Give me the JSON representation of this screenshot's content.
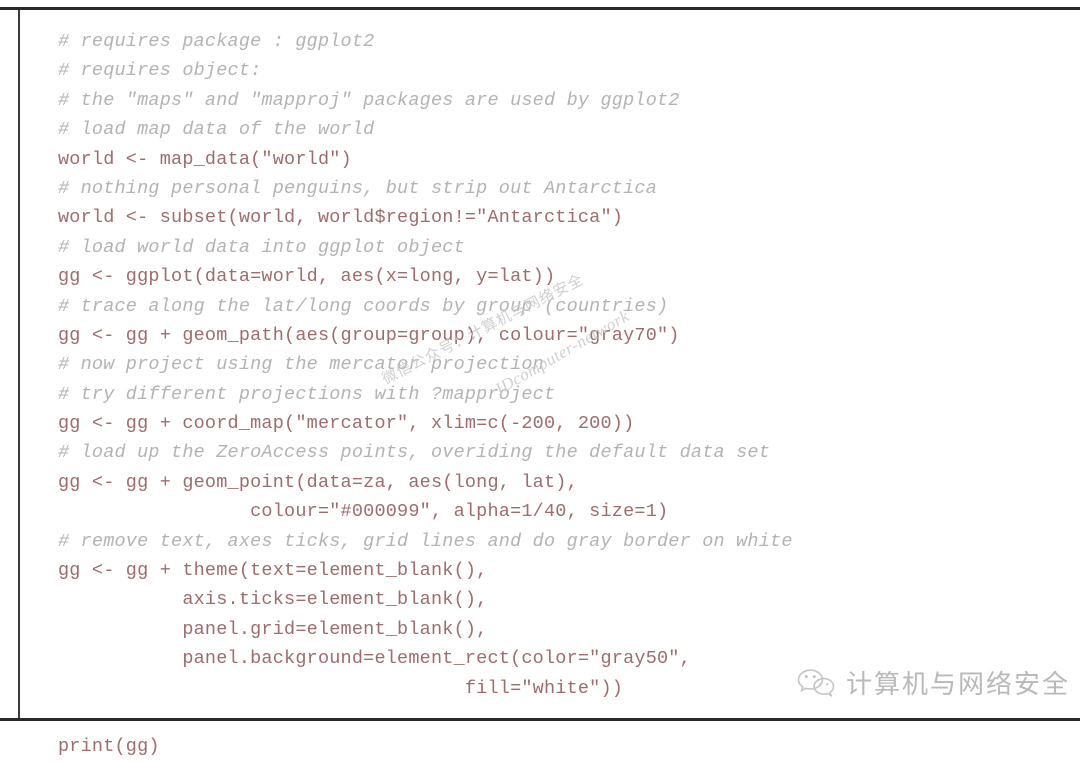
{
  "document": {
    "type": "code-listing",
    "language": "R",
    "title": "ggplot2 world map + ZeroAccess points code listing"
  },
  "colors": {
    "comment": "#b5b2b2",
    "code": "#9e6c6c",
    "rule": "#2b2b2b",
    "watermark": "#cdcdcd",
    "page_background": "#ffffff"
  },
  "code": {
    "lines": [
      {
        "kind": "comment",
        "text": "# requires package : ggplot2"
      },
      {
        "kind": "comment",
        "text": "# requires object:"
      },
      {
        "kind": "comment",
        "text": "# the \"maps\" and \"mapproj\" packages are used by ggplot2"
      },
      {
        "kind": "comment",
        "text": "# load map data of the world"
      },
      {
        "kind": "code",
        "text": "world <- map_data(\"world\")"
      },
      {
        "kind": "comment",
        "text": "# nothing personal penguins, but strip out Antarctica"
      },
      {
        "kind": "code",
        "text": "world <- subset(world, world$region!=\"Antarctica\")"
      },
      {
        "kind": "comment",
        "text": "# load world data into ggplot object"
      },
      {
        "kind": "code",
        "text": "gg <- ggplot(data=world, aes(x=long, y=lat))"
      },
      {
        "kind": "comment",
        "text": "# trace along the lat/long coords by group (countries)"
      },
      {
        "kind": "code",
        "text": "gg <- gg + geom_path(aes(group=group), colour=\"gray70\")"
      },
      {
        "kind": "comment",
        "text": "# now project using the mercator projection"
      },
      {
        "kind": "comment",
        "text": "# try different projections with ?mapproject"
      },
      {
        "kind": "code",
        "text": "gg <- gg + coord_map(\"mercator\", xlim=c(-200, 200))"
      },
      {
        "kind": "comment",
        "text": "# load up the ZeroAccess points, overiding the default data set"
      },
      {
        "kind": "code",
        "text": "gg <- gg + geom_point(data=za, aes(long, lat),"
      },
      {
        "kind": "code",
        "text": "                 colour=\"#000099\", alpha=1/40, size=1)"
      },
      {
        "kind": "comment",
        "text": "# remove text, axes ticks, grid lines and do gray border on white"
      },
      {
        "kind": "code",
        "text": "gg <- gg + theme(text=element_blank(),"
      },
      {
        "kind": "code",
        "text": "           axis.ticks=element_blank(),"
      },
      {
        "kind": "code",
        "text": "           panel.grid=element_blank(),"
      },
      {
        "kind": "code",
        "text": "           panel.background=element_rect(color=\"gray50\","
      },
      {
        "kind": "code",
        "text": "                                    fill=\"white\"))"
      },
      {
        "kind": "blank",
        "text": " "
      },
      {
        "kind": "code",
        "text": "print(gg)"
      }
    ]
  },
  "watermarks": {
    "rotated_cn": "微信公众号：计算机与网络安全",
    "rotated_en": "IDcomputer-network"
  },
  "brand": {
    "icon": "wechat-icon",
    "label": "计算机与网络安全"
  }
}
